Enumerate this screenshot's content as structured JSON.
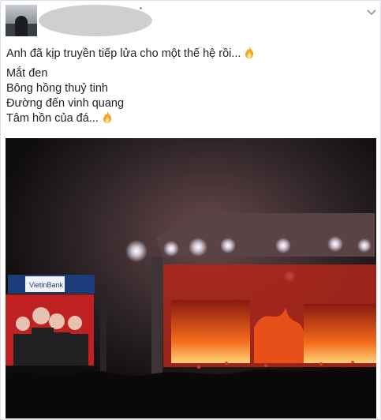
{
  "post": {
    "author_avatar_icon": "profile-photo",
    "author_name_redacted": true,
    "options_icon": "chevron-down-icon",
    "lines": [
      "Anh đã kịp truyền tiếp lửa cho một thế hệ rồi...",
      "Mắt đen",
      "Bông hồng thuỷ tinh",
      "Đường đến vinh quang",
      "Tâm hồn của đá..."
    ],
    "emoji_icon": "fire-emoji-icon",
    "photo": {
      "alt_icon": "concert-stage-photo",
      "banner_text": "VietinBank",
      "colors": {
        "stage_fire": "#e8501a",
        "sky": "#2a2628",
        "screen_red": "#c0201f"
      }
    }
  }
}
